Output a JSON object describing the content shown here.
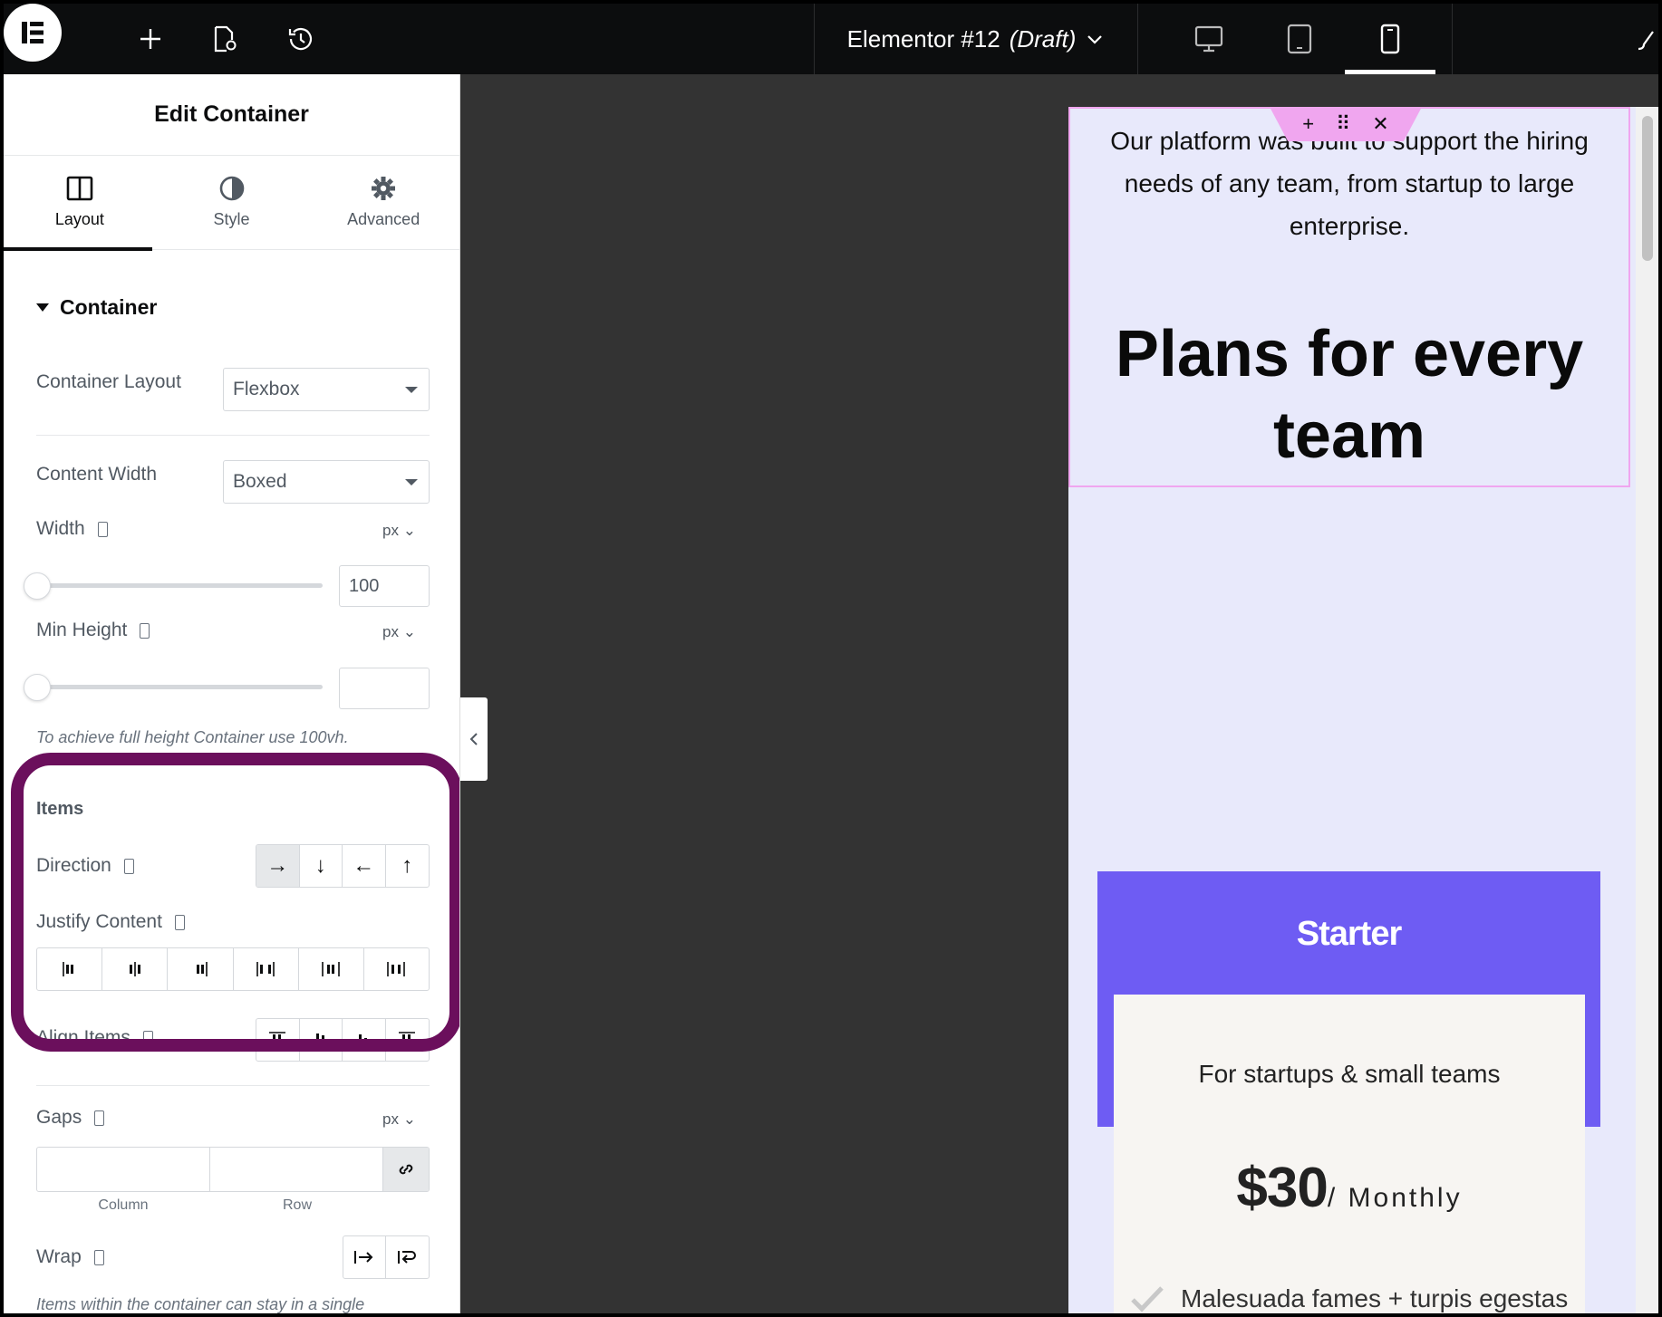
{
  "topbar": {
    "document_title": "Elementor #12",
    "document_status": "(Draft)",
    "icons": [
      "elementor-logo-icon",
      "add-icon",
      "page-settings-icon",
      "history-icon",
      "chevron-down-icon",
      "desktop-icon",
      "tablet-icon",
      "mobile-icon"
    ]
  },
  "panel": {
    "title": "Edit Container",
    "tabs": [
      {
        "label": "Layout",
        "icon": "columns-icon",
        "active": true
      },
      {
        "label": "Style",
        "icon": "half-circle-icon",
        "active": false
      },
      {
        "label": "Advanced",
        "icon": "gear-icon",
        "active": false
      }
    ],
    "section_title": "Container",
    "container_layout": {
      "label": "Container Layout",
      "value": "Flexbox"
    },
    "content_width": {
      "label": "Content Width",
      "value": "Boxed"
    },
    "width": {
      "label": "Width",
      "unit": "px",
      "value": "100"
    },
    "min_height": {
      "label": "Min Height",
      "unit": "px",
      "value": ""
    },
    "min_height_hint": "To achieve full height Container use 100vh.",
    "items_heading": "Items",
    "direction": {
      "label": "Direction",
      "options": [
        "→",
        "↓",
        "←",
        "↑"
      ],
      "selected": 0
    },
    "justify_content": {
      "label": "Justify Content"
    },
    "align_items": {
      "label": "Align Items"
    },
    "gaps": {
      "label": "Gaps",
      "unit": "px",
      "column_label": "Column",
      "row_label": "Row",
      "column": "",
      "row": ""
    },
    "wrap": {
      "label": "Wrap",
      "hint": "Items within the container can stay in a single"
    }
  },
  "preview": {
    "intro": "Our platform was built to support the hiring needs of any team, from startup to large enterprise.",
    "headline": "Plans for every team",
    "plan": {
      "name": "Starter",
      "subtitle": "For startups & small teams",
      "price": "$30",
      "period": "/ Monthly",
      "feature": "Malesuada fames + turpis egestas"
    }
  },
  "colors": {
    "highlight": "#6b0f5c",
    "plan_header": "#6e5cf3",
    "selection": "#f0a6ef",
    "preview_bg": "#e8e9fb"
  }
}
